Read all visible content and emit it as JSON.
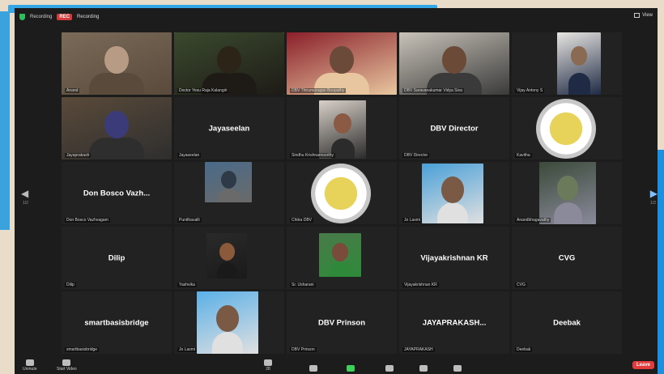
{
  "topbar": {
    "title": "Recording",
    "rec_badge": "REC",
    "rec_state": "Recording",
    "view_label": "View"
  },
  "tiles": [
    {
      "type": "video",
      "name": "",
      "label": "Anand",
      "speaker": false
    },
    {
      "type": "video",
      "name": "",
      "label": "Doctor Yesu Raja Kalangiri",
      "speaker": true
    },
    {
      "type": "video",
      "name": "",
      "label": "DBV Thirumurugan Boopathy",
      "speaker": false
    },
    {
      "type": "video",
      "name": "",
      "label": "DBV Saravanakumar Vidya Siva",
      "speaker": false
    },
    {
      "type": "video",
      "name": "",
      "label": "Vijay Antony S",
      "speaker": false
    },
    {
      "type": "video",
      "name": "",
      "label": "Jayaprakash",
      "speaker": false
    },
    {
      "type": "name",
      "name": "Jayaseelan",
      "label": "Jayaseelan",
      "speaker": false
    },
    {
      "type": "video",
      "name": "",
      "label": "Sindhu Krishnamoorthy",
      "speaker": false
    },
    {
      "type": "name",
      "name": "DBV Director",
      "label": "DBV Director",
      "speaker": false
    },
    {
      "type": "logo",
      "name": "",
      "label": "Kavitha",
      "speaker": false
    },
    {
      "type": "name",
      "name": "Don Bosco Vazh...",
      "label": "Don Bosco Vazhvagam",
      "speaker": false
    },
    {
      "type": "video",
      "name": "",
      "label": "Punithavalli",
      "speaker": false
    },
    {
      "type": "logo",
      "name": "",
      "label": "Chitra DBV",
      "speaker": false
    },
    {
      "type": "video",
      "name": "",
      "label": "Jo Laxmi",
      "speaker": false
    },
    {
      "type": "video",
      "name": "",
      "label": "Anandbhagavathy",
      "speaker": false
    },
    {
      "type": "name",
      "name": "Dilip",
      "label": "Dilip",
      "speaker": false
    },
    {
      "type": "video",
      "name": "",
      "label": "Yashvika",
      "speaker": false
    },
    {
      "type": "video",
      "name": "",
      "label": "Sr. Usharani",
      "speaker": false
    },
    {
      "type": "name",
      "name": "Vijayakrishnan KR",
      "label": "Vijayakrishnan KR",
      "speaker": false
    },
    {
      "type": "name",
      "name": "CVG",
      "label": "CVG",
      "speaker": false
    },
    {
      "type": "name",
      "name": "smartbasisbridge",
      "label": "smartbasisbridge",
      "speaker": false
    },
    {
      "type": "video",
      "name": "",
      "label": "Jo Laxmi",
      "speaker": false
    },
    {
      "type": "name",
      "name": "DBV Prinson",
      "label": "DBV Prinson",
      "speaker": false
    },
    {
      "type": "name",
      "name": "JAYAPRAKASH...",
      "label": "JAYAPRAKASH",
      "speaker": false
    },
    {
      "type": "name",
      "name": "Deebak",
      "label": "Deebak",
      "speaker": false
    }
  ],
  "nav": {
    "left_arrow": "◀",
    "right_arrow": "▶",
    "left_page": "1/2",
    "right_page": "1/2"
  },
  "toolbar": {
    "mute_label": "Unmute",
    "video_label": "Start Video",
    "participants_count": "28",
    "end_label": "Leave"
  },
  "colors": {
    "window_bg": "#1c1c1c",
    "speaker_outline": "#d8e04a",
    "end_button": "#e23c3c",
    "rec_badge": "#d63a3a"
  }
}
